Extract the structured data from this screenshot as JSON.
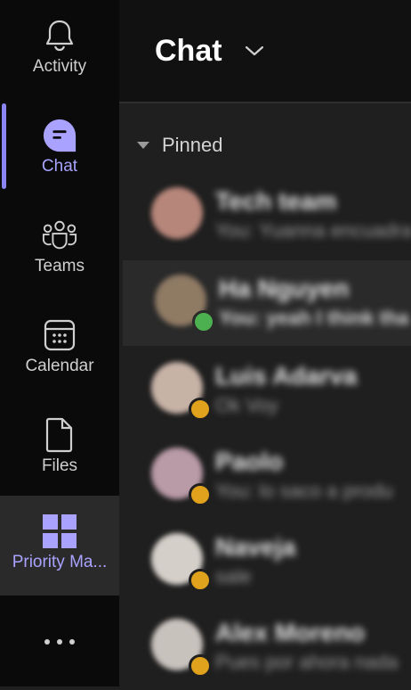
{
  "rail": {
    "items": [
      {
        "label": "Activity",
        "icon": "bell-icon"
      },
      {
        "label": "Chat",
        "icon": "chat-icon",
        "active": true
      },
      {
        "label": "Teams",
        "icon": "teams-icon"
      },
      {
        "label": "Calendar",
        "icon": "calendar-icon"
      },
      {
        "label": "Files",
        "icon": "file-icon"
      },
      {
        "label": "Priority Ma...",
        "icon": "app-grid-icon"
      }
    ],
    "more_icon": "more-icon"
  },
  "header": {
    "title": "Chat"
  },
  "section": {
    "label": "Pinned"
  },
  "chats": [
    {
      "name": "Tech team",
      "preview": "You: Yuanna encuadra",
      "avatar_color": "#b7867a",
      "badge": ""
    },
    {
      "name": "Ha Nguyen",
      "preview": "You: yeah I think tha",
      "avatar_color": "#8f7a64",
      "badge": "#4caf50",
      "selected": true
    },
    {
      "name": "Luis Adarva",
      "preview": "Ok Voy",
      "avatar_color": "#c7b2a6",
      "badge": "#e0a21c"
    },
    {
      "name": "Paolo",
      "preview": "You: lo saco a produ",
      "avatar_color": "#b99aa7",
      "badge": "#e0a21c"
    },
    {
      "name": "Naveja",
      "preview": "sale",
      "avatar_color": "#d4cfc9",
      "badge": "#e0a21c"
    },
    {
      "name": "Alex Moreno",
      "preview": "Pues por ahora nada",
      "avatar_color": "#c8c2bd",
      "badge": "#e0a21c"
    }
  ],
  "colors": {
    "accent": "#8b84f2",
    "rail_bg": "#0a0a0a",
    "main_bg": "#1f1f1f"
  }
}
